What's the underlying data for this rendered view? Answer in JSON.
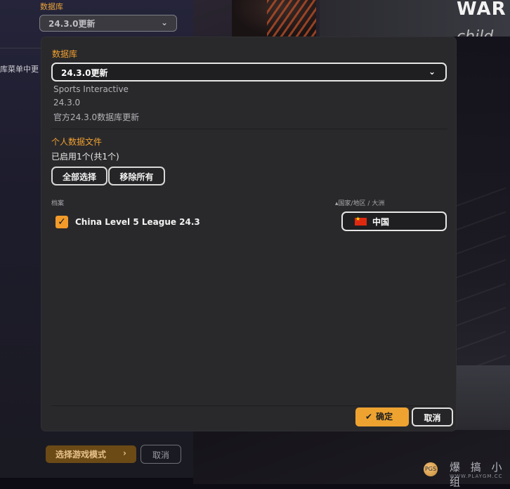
{
  "sidebar": {
    "database_label": "数据库",
    "database_value": "24.3.0更新",
    "menu_text": "库菜单中更",
    "select_mode_label": "选择游戏模式",
    "select_mode_arrow": "›",
    "cancel_label": "取消"
  },
  "background": {
    "war_text": "WAR",
    "child_text": "child"
  },
  "modal": {
    "database_label": "数据库",
    "database_value": "24.3.0更新",
    "publisher": "Sports Interactive",
    "version": "24.3.0",
    "description": "官方24.3.0数据库更新",
    "personal_files_label": "个人数据文件",
    "enabled_text": "已启用1个(共1个)",
    "select_all_label": "全部选择",
    "remove_all_label": "移除所有",
    "files_header": "档案",
    "country_header": "▴国家/地区 / 大洲",
    "files": [
      {
        "name": "China Level 5 League 24.3",
        "checked": true,
        "country": "中国",
        "flag": "china-flag"
      }
    ],
    "ok_label": "确定",
    "cancel_label": "取消"
  },
  "watermark": {
    "logo_text": "PGS",
    "text": "爆 搞 小 组",
    "sub": "WWW.PLAYGM.CC"
  },
  "colors": {
    "accent": "#f0a030",
    "modal_bg": "#29292b",
    "ok_button": "#eea331"
  }
}
